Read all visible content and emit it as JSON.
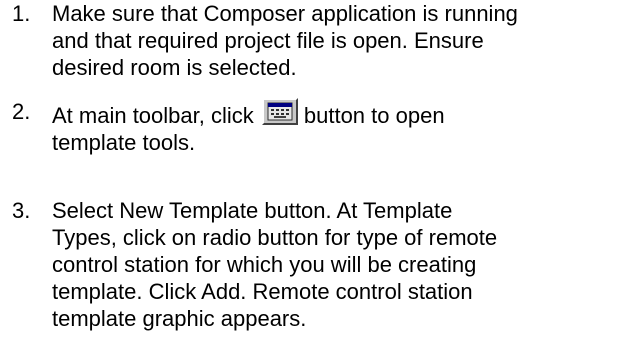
{
  "steps": [
    {
      "number": "1.",
      "lines": [
        "Make sure that Composer application is running",
        "and that required project file is open. Ensure",
        "desired room is selected."
      ]
    },
    {
      "number": "2.",
      "before_icon": "At main toolbar, click",
      "after_icon": "button to open",
      "icon": "template-tools-icon",
      "lines": [
        "template tools."
      ]
    },
    {
      "number": "3.",
      "lines": [
        "Select New Template button. At Template",
        "Types, click on radio button for type of remote",
        "control station for which you will be creating",
        "template. Click Add. Remote control station",
        "template graphic appears."
      ]
    }
  ]
}
